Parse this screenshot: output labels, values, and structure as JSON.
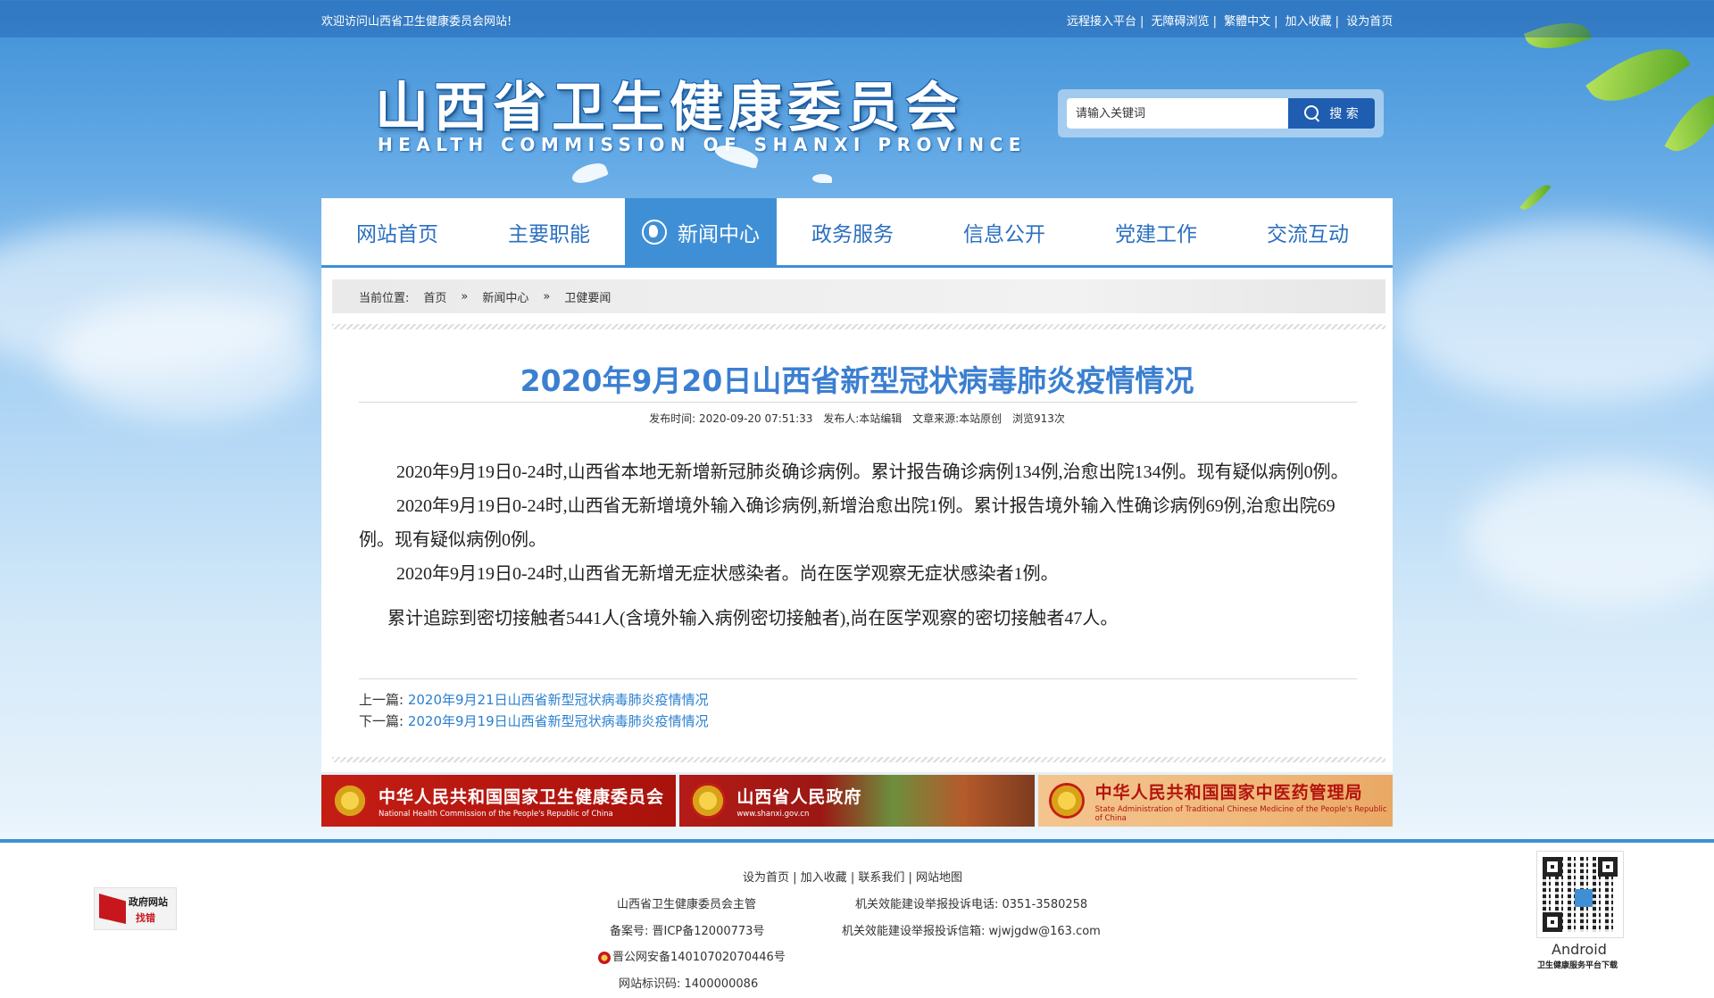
{
  "topbar": {
    "welcome": "欢迎访问山西省卫生健康委员会网站!",
    "links": [
      "远程接入平台",
      "无障碍浏览",
      "繁體中文",
      "加入收藏",
      "设为首页"
    ]
  },
  "header": {
    "logo_cn": "山西省卫生健康委员会",
    "logo_en": "HEALTH COMMISSION OF SHANXI PROVINCE",
    "search_placeholder": "请输入关键词",
    "search_button": "搜 索"
  },
  "nav": {
    "items": [
      "网站首页",
      "主要职能",
      "新闻中心",
      "政务服务",
      "信息公开",
      "党建工作",
      "交流互动"
    ],
    "active_index": 2
  },
  "breadcrumb": {
    "label": "当前位置:",
    "items": [
      "首页",
      "»",
      "新闻中心",
      "»",
      "卫健要闻"
    ]
  },
  "article": {
    "title": "2020年9月20日山西省新型冠状病毒肺炎疫情情况",
    "meta": {
      "publish_time": "发布时间:  2020-09-20 07:51:33",
      "publisher": "发布人:本站编辑",
      "source": "文章来源:本站原创",
      "views": "浏览913次"
    },
    "paragraphs": [
      "2020年9月19日0-24时,山西省本地无新增新冠肺炎确诊病例。累计报告确诊病例134例,治愈出院134例。现有疑似病例0例。",
      "2020年9月19日0-24时,山西省无新增境外输入确诊病例,新增治愈出院1例。累计报告境外输入性确诊病例69例,治愈出院69例。现有疑似病例0例。",
      "2020年9月19日0-24时,山西省无新增无症状感染者。尚在医学观察无症状感染者1例。",
      "累计追踪到密切接触者5441人(含境外输入病例密切接触者),尚在医学观察的密切接触者47人。"
    ],
    "prev_label": "上一篇:",
    "prev_link": "2020年9月21日山西省新型冠状病毒肺炎疫情情况",
    "next_label": "下一篇:",
    "next_link": "2020年9月19日山西省新型冠状病毒肺炎疫情情况"
  },
  "banners": [
    {
      "cn": "中华人民共和国国家卫生健康委员会",
      "en": "National Health Commission of the People's Republic of China"
    },
    {
      "cn": "山西省人民政府",
      "en": "www.shanxi.gov.cn"
    },
    {
      "cn": "中华人民共和国国家中医药管理局",
      "en": "State Administration of Traditional Chinese Medicine of the People's Republic of China"
    }
  ],
  "footer": {
    "links": [
      "设为首页",
      "加入收藏",
      "联系我们",
      "网站地图"
    ],
    "sponsor": "山西省卫生健康委员会主管",
    "phone": "机关效能建设举报投诉电话:  0351-3580258",
    "icp": "备案号:  晋ICP备12000773号",
    "email": "机关效能建设举报投诉信箱:  wjwjgdw@163.com",
    "police": "晋公网安备14010702070446号",
    "site_id": "网站标识码:  1400000086",
    "gov_badge_line1": "政府网站",
    "gov_badge_line2": "找错",
    "app_label": "Android",
    "app_sub": "卫生健康服务平台下载"
  }
}
